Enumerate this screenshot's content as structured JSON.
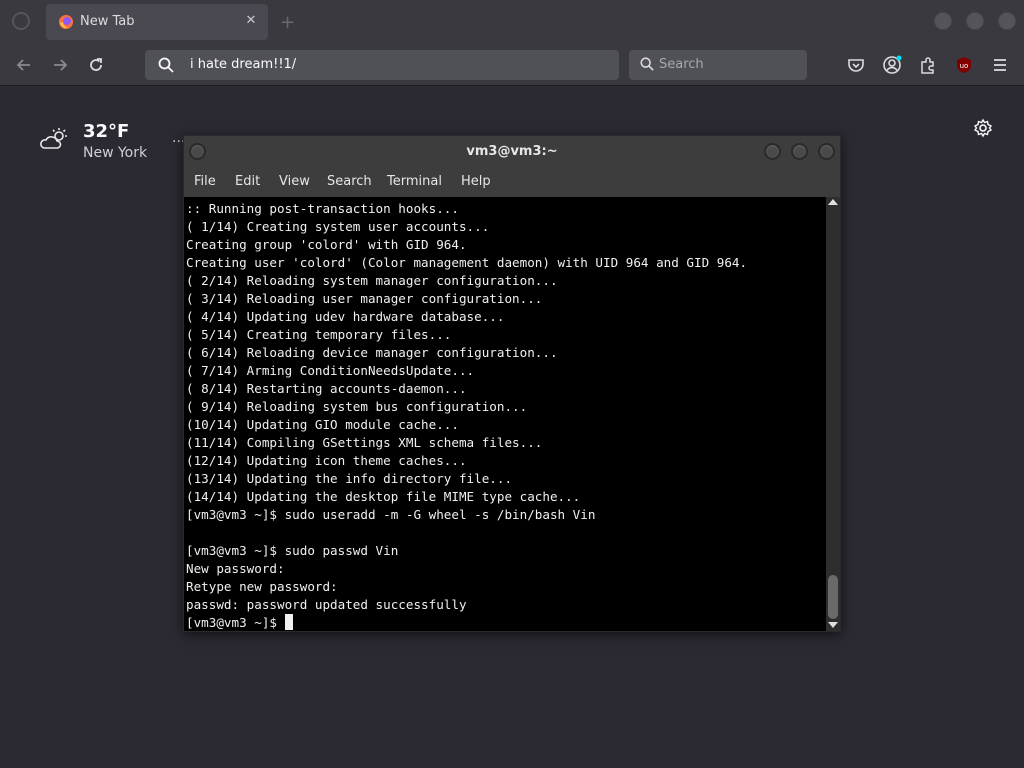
{
  "colors": {
    "chrome": "#3a3940",
    "page_bg": "#2b2a33",
    "terminal_bg": "#000000",
    "terminal_text": "#f0f0f0"
  },
  "browser": {
    "tab": {
      "title": "New Tab",
      "close": "✕"
    },
    "url_bar": {
      "value": "i hate dream!!1/"
    },
    "search_box": {
      "placeholder": "Search"
    },
    "icons": [
      "back-icon",
      "forward-icon",
      "reload-icon",
      "pocket-icon",
      "account-icon",
      "extensions-icon",
      "ublock-icon",
      "menu-icon"
    ]
  },
  "newtab": {
    "weather": {
      "temp": "32°F",
      "city": "New York",
      "menu": "..."
    }
  },
  "terminal": {
    "title": "vm3@vm3:~",
    "menu": [
      "File",
      "Edit",
      "View",
      "Search",
      "Terminal",
      "Help"
    ],
    "lines": [
      ":: Running post-transaction hooks...",
      "( 1/14) Creating system user accounts...",
      "Creating group 'colord' with GID 964.",
      "Creating user 'colord' (Color management daemon) with UID 964 and GID 964.",
      "( 2/14) Reloading system manager configuration...",
      "( 3/14) Reloading user manager configuration...",
      "( 4/14) Updating udev hardware database...",
      "( 5/14) Creating temporary files...",
      "( 6/14) Reloading device manager configuration...",
      "( 7/14) Arming ConditionNeedsUpdate...",
      "( 8/14) Restarting accounts-daemon...",
      "( 9/14) Reloading system bus configuration...",
      "(10/14) Updating GIO module cache...",
      "(11/14) Compiling GSettings XML schema files...",
      "(12/14) Updating icon theme caches...",
      "(13/14) Updating the info directory file...",
      "(14/14) Updating the desktop file MIME type cache...",
      "[vm3@vm3 ~]$ sudo useradd -m -G wheel -s /bin/bash Vin",
      "",
      "[vm3@vm3 ~]$ sudo passwd Vin",
      "New password:",
      "Retype new password:",
      "passwd: password updated successfully"
    ],
    "prompt": "[vm3@vm3 ~]$ "
  }
}
